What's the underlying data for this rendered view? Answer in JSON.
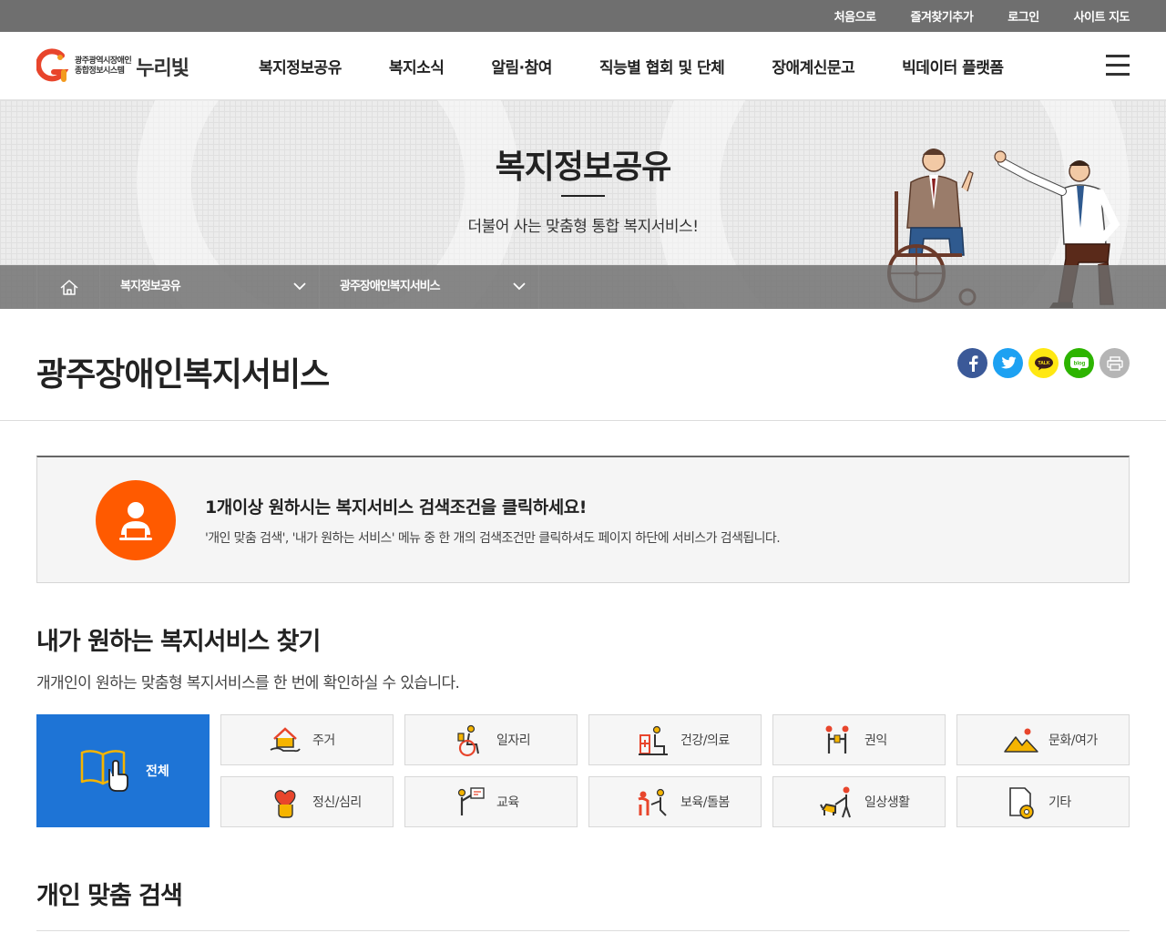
{
  "topbar": {
    "links": [
      "처음으로",
      "즐겨찾기추가",
      "로그인",
      "사이트 지도"
    ]
  },
  "header": {
    "logo_sub_line1": "광주광역시장애인",
    "logo_sub_line2": "종합정보시스템",
    "logo_main": "누리빛",
    "nav": [
      "복지정보공유",
      "복지소식",
      "알림·참여",
      "직능별 협회 및 단체",
      "장애계신문고",
      "빅데이터 플랫폼"
    ]
  },
  "hero": {
    "title": "복지정보공유",
    "subtitle": "더불어 사는 맞춤형 통합 복지서비스!"
  },
  "breadcrumb": {
    "level1": "복지정보공유",
    "level2": "광주장애인복지서비스"
  },
  "page": {
    "title": "광주장애인복지서비스"
  },
  "share": {
    "facebook_color": "#3b5998",
    "twitter_color": "#1da1f2",
    "kakao_color": "#ffe812",
    "blog_color": "#2db400",
    "print_color": "#b5b5b5",
    "kakao_text": "TALK",
    "blog_text": "blog"
  },
  "notice": {
    "heading": "1개이상 원하시는 복지서비스 검색조건을 클릭하세요!",
    "description": "'개인 맞춤 검색', '내가 원하는 서비스' 메뉴 중 한 개의 검색조건만 클릭하셔도 페이지 하단에 서비스가 검색됩니다."
  },
  "section": {
    "title": "내가 원하는 복지서비스 찾기",
    "description": "개개인이 원하는 맞춤형 복지서비스를 한 번에 확인하실 수 있습니다.",
    "all_label": "전체",
    "categories": [
      "주거",
      "일자리",
      "건강/의료",
      "권익",
      "문화/여가",
      "정신/심리",
      "교육",
      "보육/돌봄",
      "일상생활",
      "기타"
    ]
  },
  "section2": {
    "title": "개인 맞춤 검색"
  },
  "colors": {
    "accent_blue": "#1e74d6",
    "accent_orange": "#ff5a00"
  }
}
